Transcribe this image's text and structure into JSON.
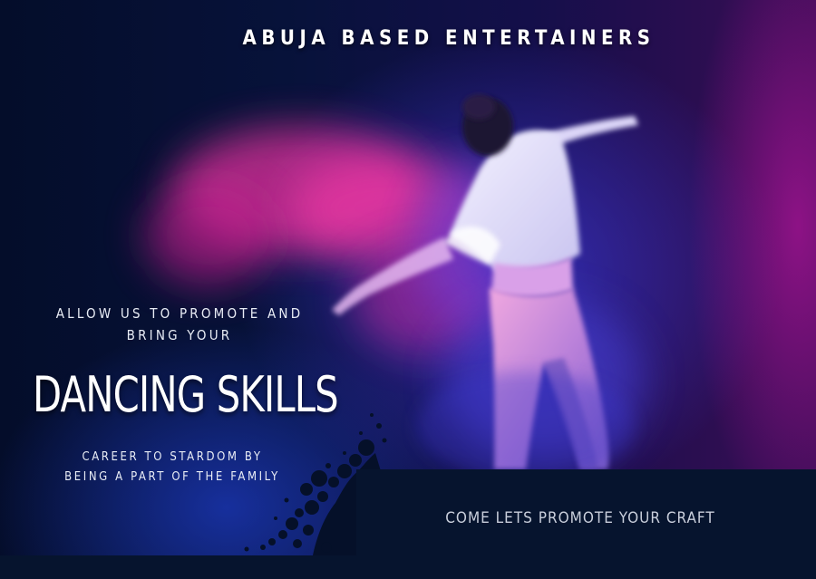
{
  "poster": {
    "title": "ABUJA BASED ENTERTAINERS",
    "intro_line1": "ALLOW US TO PROMOTE AND",
    "intro_line2": "BRING YOUR",
    "headline": "DANCING SKILLS",
    "career_line1": "CAREER TO STARDOM BY",
    "career_line2": "BEING A PART OF THE FAMILY",
    "cta": "COME LETS PROMOTE YOUR CRAFT"
  },
  "colors": {
    "background": "#030d24",
    "panel": "#06142e",
    "magenta": "#e0309c",
    "blue": "#3c32c8",
    "text": "#ffffff"
  },
  "icons": [
    "dancer-figure",
    "ink-splatter"
  ]
}
